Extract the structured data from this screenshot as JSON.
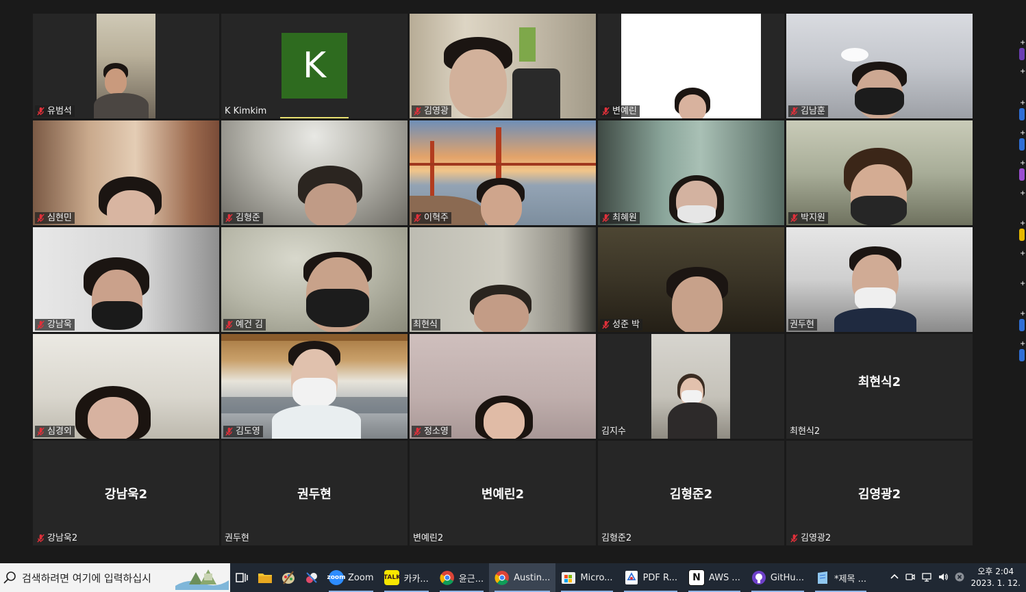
{
  "tiles": [
    {
      "name": "유범석",
      "muted": true
    },
    {
      "name": "K Kimkim",
      "muted": false,
      "avatar_letter": "K"
    },
    {
      "name": "김영광",
      "muted": true
    },
    {
      "name": "변예린",
      "muted": true
    },
    {
      "name": "김남훈",
      "muted": true
    },
    {
      "name": "심현민",
      "muted": true
    },
    {
      "name": "김형준",
      "muted": true
    },
    {
      "name": "이혁주",
      "muted": true
    },
    {
      "name": "최혜원",
      "muted": true
    },
    {
      "name": "박지원",
      "muted": true
    },
    {
      "name": "강남욱",
      "muted": true
    },
    {
      "name": "예건 김",
      "muted": true
    },
    {
      "name": "최현식",
      "muted": false
    },
    {
      "name": "성준 박",
      "muted": true
    },
    {
      "name": "권두현",
      "muted": false,
      "active_speaker": true
    },
    {
      "name": "심경외",
      "muted": true
    },
    {
      "name": "김도영",
      "muted": true
    },
    {
      "name": "정소영",
      "muted": true
    },
    {
      "name": "김지수",
      "muted": false
    },
    {
      "name": "최현식2",
      "muted": false,
      "display_name": "최현식2"
    },
    {
      "name": "강남욱2",
      "muted": true,
      "display_name": "강남욱2"
    },
    {
      "name": "권두현",
      "muted": false,
      "display_name": "권두현"
    },
    {
      "name": "변예린2",
      "muted": false,
      "display_name": "변예린2"
    },
    {
      "name": "김형준2",
      "muted": false,
      "display_name": "김형준2"
    },
    {
      "name": "김영광2",
      "muted": true,
      "display_name": "김영광2"
    }
  ],
  "colors": {
    "active_speaker_border": "#d6e35a",
    "muted_icon": "#e0303a",
    "taskbar_bg": "#202833"
  },
  "taskbar": {
    "search_placeholder": "검색하려면 여기에 입력하십시",
    "apps": [
      {
        "label": "Zoom",
        "icon": "zoom-icon"
      },
      {
        "label": "카카...",
        "icon": "kakaotalk-icon"
      },
      {
        "label": "윤근...",
        "icon": "chrome-icon"
      },
      {
        "label": "Austin...",
        "icon": "chrome-icon",
        "active": true
      },
      {
        "label": "Micro...",
        "icon": "microsoft-store-icon"
      },
      {
        "label": "PDF R...",
        "icon": "pdf-reader-icon"
      },
      {
        "label": "AWS ...",
        "icon": "notion-icon"
      },
      {
        "label": "GitHu...",
        "icon": "github-icon"
      },
      {
        "label": "*제목 ...",
        "icon": "notepad-icon"
      }
    ],
    "clock_time": "오후 2:04",
    "clock_date": "2023. 1. 12."
  }
}
